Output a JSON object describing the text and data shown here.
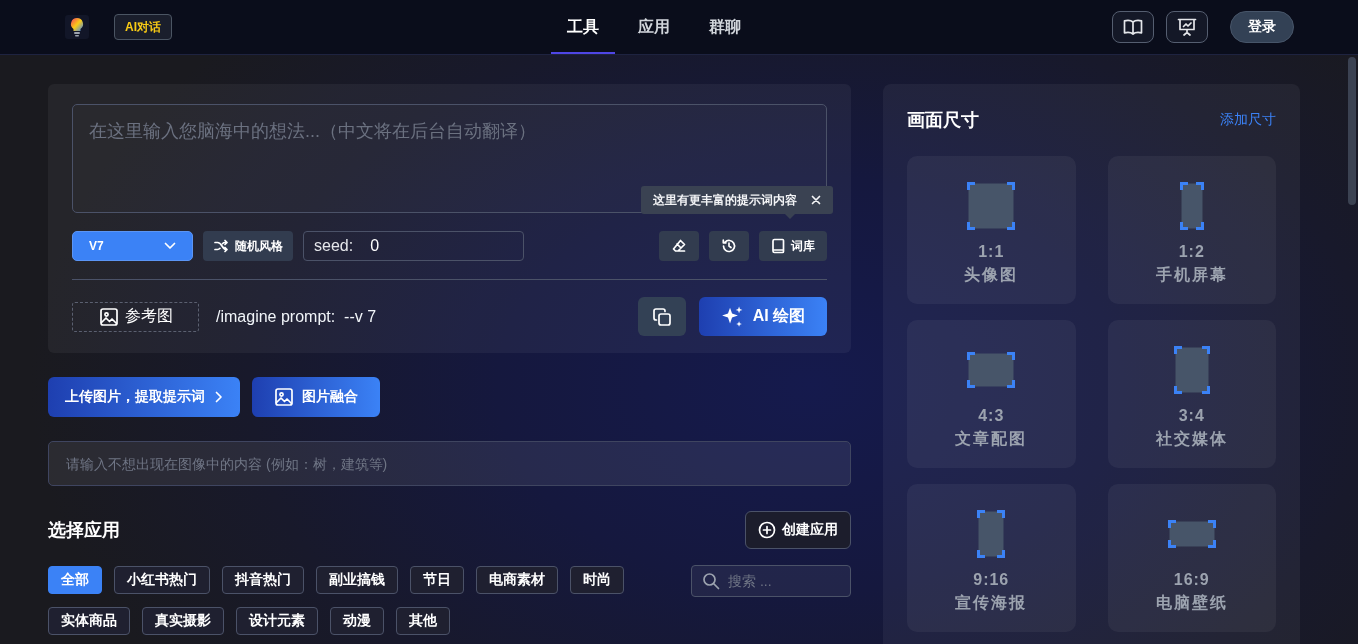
{
  "header": {
    "badge": "AI对话",
    "nav": [
      {
        "label": "工具",
        "selected": true
      },
      {
        "label": "应用",
        "selected": false
      },
      {
        "label": "群聊",
        "selected": false
      }
    ],
    "login_button": "登录"
  },
  "prompt_panel": {
    "prompt": {
      "placeholder": "在这里输入您脑海中的想法...（中文将在后台自动翻译）"
    },
    "version_select": {
      "value": "V7"
    },
    "random_style_button": "随机风格",
    "seed": {
      "label": "seed:",
      "value": "0"
    },
    "library_button": "词库",
    "tooltip": "这里有更丰富的提示词内容",
    "reference_button": "参考图",
    "command": "/imagine prompt:  --v 7",
    "generate_button": "AI 绘图"
  },
  "image_actions": [
    {
      "label": "上传图片，提取提示词",
      "kind": "upload"
    },
    {
      "label": "图片融合",
      "kind": "blend"
    }
  ],
  "negative_prompt": {
    "placeholder": "请输入不想出现在图像中的内容 (例如：树，建筑等)"
  },
  "apps": {
    "title": "选择应用",
    "create_button": "创建应用",
    "categories": [
      {
        "label": "全部",
        "selected": true
      },
      {
        "label": "小红书热门",
        "selected": false
      },
      {
        "label": "抖音热门",
        "selected": false
      },
      {
        "label": "副业搞钱",
        "selected": false
      },
      {
        "label": "节日",
        "selected": false
      },
      {
        "label": "电商素材",
        "selected": false
      },
      {
        "label": "时尚",
        "selected": false
      },
      {
        "label": "实体商品",
        "selected": false
      },
      {
        "label": "真实摄影",
        "selected": false
      },
      {
        "label": "设计元素",
        "selected": false
      },
      {
        "label": "动漫",
        "selected": false
      },
      {
        "label": "其他",
        "selected": false
      }
    ],
    "search": {
      "placeholder": "搜索 ..."
    }
  },
  "size_panel": {
    "title": "画面尺寸",
    "add_link": "添加尺寸",
    "sizes": [
      {
        "ratio": "1:1",
        "label": "头像图",
        "kind": "square",
        "selected": false
      },
      {
        "ratio": "1:2",
        "label": "手机屏幕",
        "kind": "half",
        "selected": false
      },
      {
        "ratio": "4:3",
        "label": "文章配图",
        "kind": "landscape",
        "selected": false
      },
      {
        "ratio": "3:4",
        "label": "社交媒体",
        "kind": "portrait",
        "selected": false
      },
      {
        "ratio": "9:16",
        "label": "宣传海报",
        "kind": "tall",
        "selected": false
      },
      {
        "ratio": "16:9",
        "label": "电脑壁纸",
        "kind": "wide",
        "selected": false
      }
    ]
  }
}
